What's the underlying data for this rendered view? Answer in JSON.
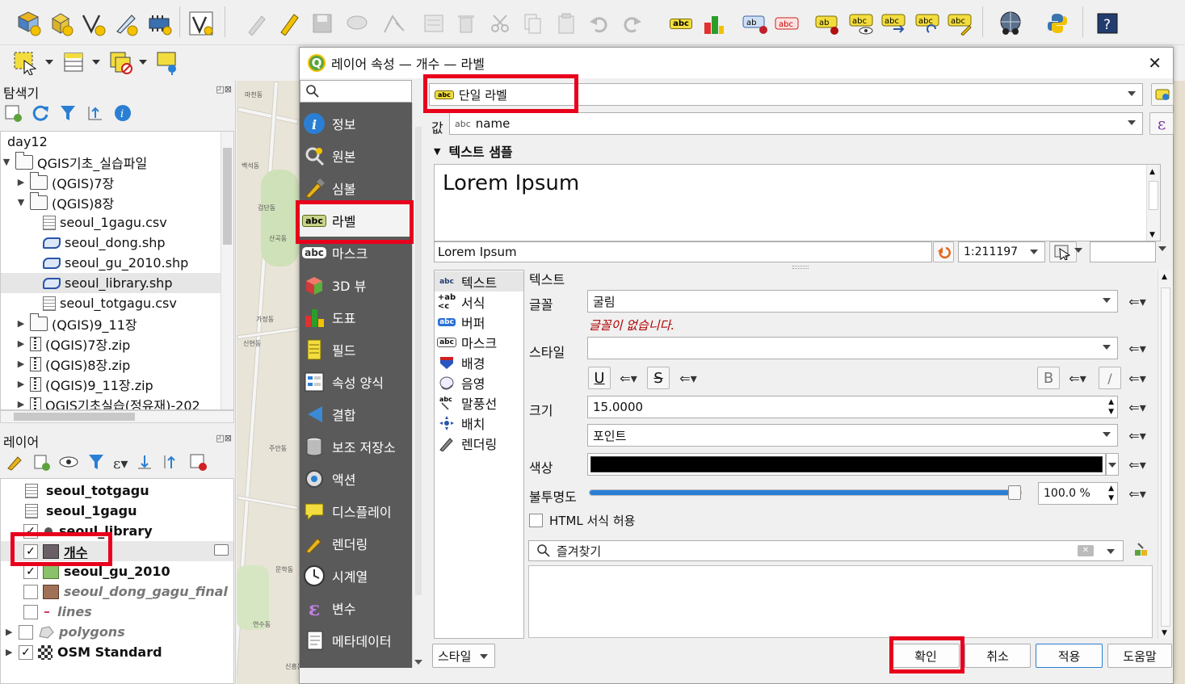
{
  "panels": {
    "browser": {
      "title": "탐색기",
      "items": [
        {
          "label": "day12",
          "type": "root"
        },
        {
          "label": "QGIS기초_실습파일",
          "type": "folder"
        },
        {
          "label": "(QGIS)7장",
          "type": "folder"
        },
        {
          "label": "(QGIS)8장",
          "type": "folder"
        },
        {
          "label": "seoul_1gagu.csv",
          "type": "csv"
        },
        {
          "label": "seoul_dong.shp",
          "type": "shp"
        },
        {
          "label": "seoul_gu_2010.shp",
          "type": "shp"
        },
        {
          "label": "seoul_library.shp",
          "type": "shp"
        },
        {
          "label": "seoul_totgagu.csv",
          "type": "csv"
        },
        {
          "label": "(QGIS)9_11장",
          "type": "folder"
        },
        {
          "label": "(QGIS)7장.zip",
          "type": "zip"
        },
        {
          "label": "(QGIS)8장.zip",
          "type": "zip"
        },
        {
          "label": "(QGIS)9_11장.zip",
          "type": "zip"
        },
        {
          "label": "QGIS기초실습(정유재)-202",
          "type": "zip"
        }
      ]
    },
    "layers": {
      "title": "레이어",
      "items": [
        {
          "label": "seoul_totgagu",
          "checked": false
        },
        {
          "label": "seoul_1gagu",
          "checked": false
        },
        {
          "label": "seoul_library",
          "checked": true
        },
        {
          "label": "개수",
          "checked": true
        },
        {
          "label": "seoul_gu_2010",
          "checked": true
        },
        {
          "label": "seoul_dong_gagu_final",
          "checked": false
        },
        {
          "label": "lines",
          "checked": false
        },
        {
          "label": "polygons",
          "checked": false
        },
        {
          "label": "OSM Standard",
          "checked": true
        }
      ]
    }
  },
  "map": {
    "labels": [
      "마천동",
      "백석동",
      "검단동",
      "산곡동",
      "가정동",
      "신현동",
      "주안동",
      "문학동",
      "연수동",
      "신흥동",
      "비산동"
    ]
  },
  "dialog": {
    "title": "레이어 속성 — 개수 — 라벨",
    "nav": [
      {
        "label": "정보",
        "icon": "info-icon"
      },
      {
        "label": "원본",
        "icon": "source-icon"
      },
      {
        "label": "심볼",
        "icon": "symbology-icon"
      },
      {
        "label": "라벨",
        "icon": "labels-icon"
      },
      {
        "label": "마스크",
        "icon": "mask-icon"
      },
      {
        "label": "3D 뷰",
        "icon": "3d-view-icon"
      },
      {
        "label": "도표",
        "icon": "diagram-icon"
      },
      {
        "label": "필드",
        "icon": "fields-icon"
      },
      {
        "label": "속성 양식",
        "icon": "attributes-form-icon"
      },
      {
        "label": "결합",
        "icon": "joins-icon"
      },
      {
        "label": "보조 저장소",
        "icon": "auxiliary-storage-icon"
      },
      {
        "label": "액션",
        "icon": "actions-icon"
      },
      {
        "label": "디스플레이",
        "icon": "display-icon"
      },
      {
        "label": "렌더링",
        "icon": "rendering-icon"
      },
      {
        "label": "시계열",
        "icon": "temporal-icon"
      },
      {
        "label": "변수",
        "icon": "variables-icon"
      },
      {
        "label": "메타데이터",
        "icon": "metadata-icon"
      }
    ],
    "label_mode": "단일 라벨",
    "value_prefix": "값",
    "value_field": "name",
    "value_type_tag": "abc",
    "sample_section": "텍스트 샘플",
    "sample_text": "Lorem Ipsum",
    "sample_input": "Lorem Ipsum",
    "scale": "1:211197",
    "sub_nav": [
      {
        "label": "텍스트",
        "icon": "text-icon"
      },
      {
        "label": "서식",
        "icon": "formatting-icon"
      },
      {
        "label": "버퍼",
        "icon": "buffer-icon"
      },
      {
        "label": "마스크",
        "icon": "mask-icon"
      },
      {
        "label": "배경",
        "icon": "background-icon"
      },
      {
        "label": "음영",
        "icon": "shadow-icon"
      },
      {
        "label": "말풍선",
        "icon": "callouts-icon"
      },
      {
        "label": "배치",
        "icon": "placement-icon"
      },
      {
        "label": "렌더링",
        "icon": "rendering-icon"
      }
    ],
    "text_section_title": "텍스트",
    "font_label": "글꼴",
    "font_value": "굴림",
    "font_warning": "글꼴이 없습니다.",
    "style_label": "스타일",
    "style_value": "",
    "size_label": "크기",
    "size_value": "15.0000",
    "unit_value": "포인트",
    "color_label": "색상",
    "color_value": "#000000",
    "opacity_label": "불투명도",
    "opacity_value": "100.0 %",
    "opacity_fraction": 1.0,
    "html_label": "HTML 서식 허용",
    "favorites_placeholder": "즐겨찾기",
    "style_button": "스타일",
    "buttons": {
      "ok": "확인",
      "cancel": "취소",
      "apply": "적용",
      "help": "도움말"
    },
    "text_style_glyphs": {
      "underline": "U",
      "strike": "S",
      "bold": "B",
      "italic": "/"
    }
  },
  "colors": {
    "highlight": "#e8001c",
    "nav_bg": "#5a5a5a",
    "accent": "#2a7fd4"
  }
}
